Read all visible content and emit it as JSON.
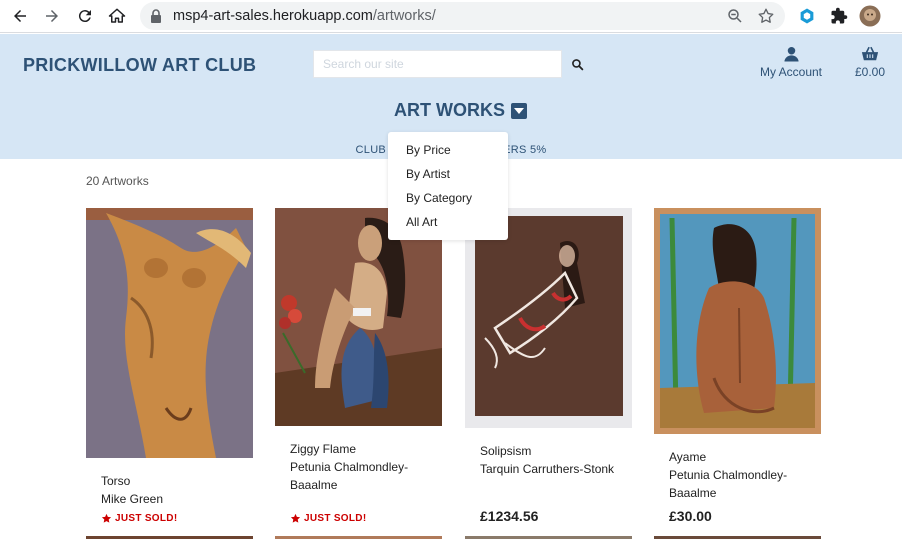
{
  "browser": {
    "url_host": "msp4-art-sales.herokuapp.com",
    "url_path": "/artworks/"
  },
  "header": {
    "brand": "PRICKWILLOW ART CLUB",
    "search_placeholder": "Search our site",
    "account_label": "My Account",
    "bag_total": "£0.00",
    "menu_title": "ART WORKS",
    "banner_left": "CLUB",
    "banner_right": "ERS 5%"
  },
  "dropdown": {
    "items": [
      "By Price",
      "By Artist",
      "By Category",
      "All Art"
    ]
  },
  "listing": {
    "count_label": "20 Artworks",
    "sold_label": "JUST SOLD!",
    "cards": [
      {
        "title": "Torso",
        "artist": "Mike Green",
        "status": "sold",
        "price": ""
      },
      {
        "title": "Ziggy Flame",
        "artist": "Petunia Chalmondley-Baaalme",
        "status": "sold",
        "price": ""
      },
      {
        "title": "Solipsism",
        "artist": "Tarquin Carruthers-Stonk",
        "status": "price",
        "price": "£1234.56"
      },
      {
        "title": "Ayame",
        "artist": "Petunia Chalmondley-Baaalme",
        "status": "price",
        "price": "£30.00"
      }
    ]
  },
  "colors": {
    "header_bg": "#d6e6f5",
    "brand": "#2e5276",
    "sold": "#cc0000"
  }
}
